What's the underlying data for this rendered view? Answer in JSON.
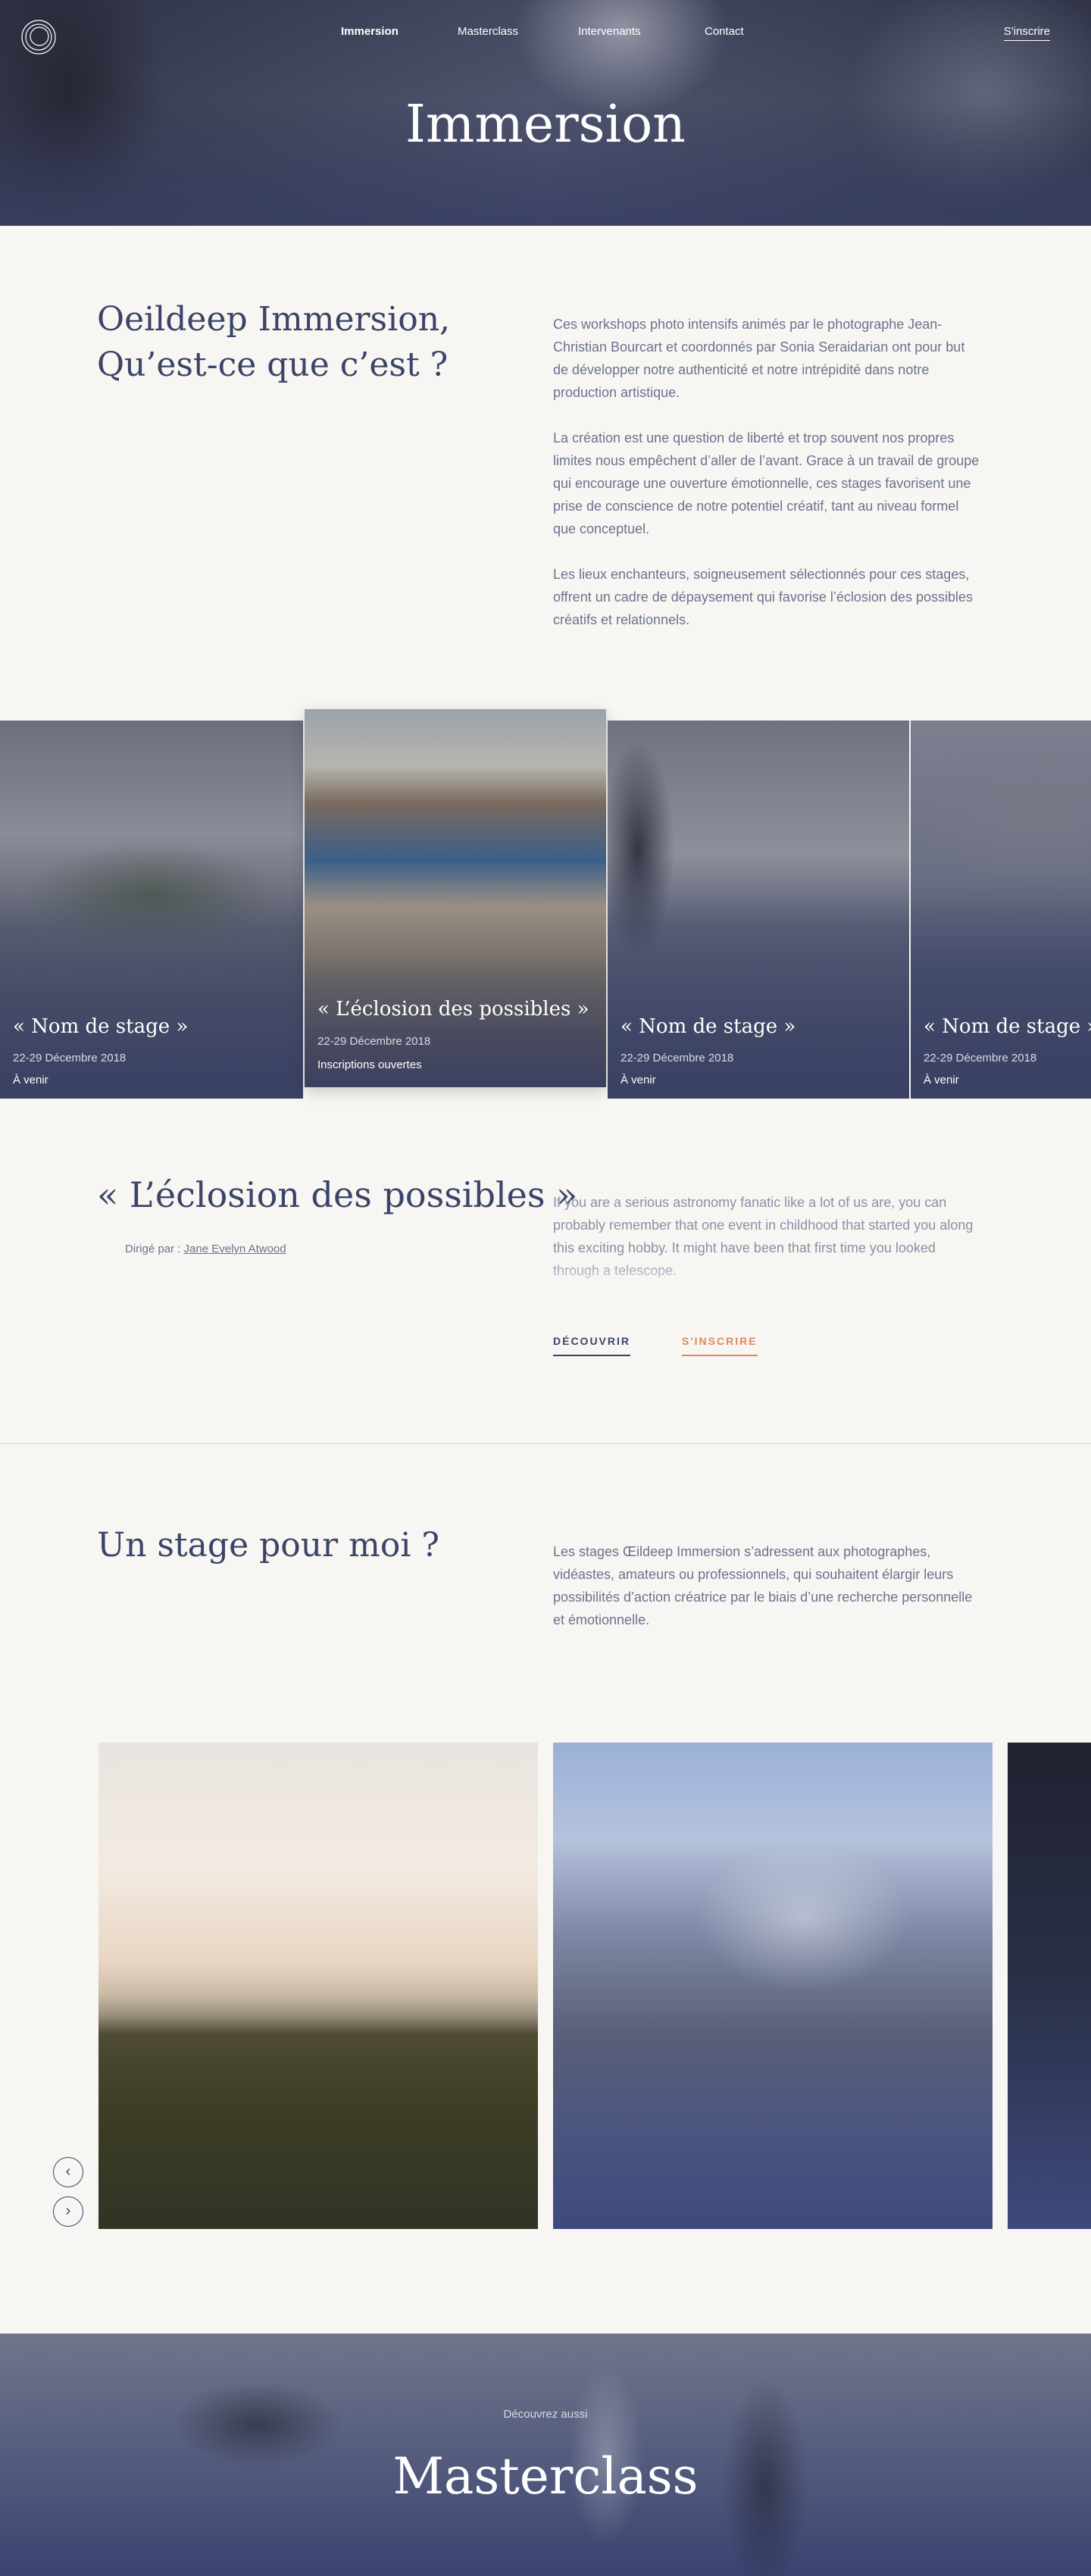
{
  "header": {
    "nav": [
      "Immersion",
      "Masterclass",
      "Intervenants",
      "Contact"
    ],
    "signup": "S'inscrire",
    "title": "Immersion"
  },
  "intro": {
    "title_line1": "Oeildeep Immersion,",
    "title_line2": "Qu’est-ce que c’est ?",
    "paragraphs": [
      "Ces workshops photo intensifs animés par le photographe Jean-Christian Bourcart et coordonnés par Sonia Seraidarian ont pour but de développer notre authenticité et notre intrépidité dans notre production artistique.",
      "La création est une question de liberté et trop souvent nos propres limites nous empêchent d’aller de l’avant. Grace à un travail de groupe qui encourage une ouverture émotionnelle, ces stages favorisent une prise de conscience de notre potentiel créatif, tant au niveau formel que conceptuel.",
      "Les lieux enchanteurs, soigneusement sélectionnés pour ces stages, offrent un cadre de dépaysement qui favorise l’éclosion des possibles créatifs et relationnels."
    ]
  },
  "stages": [
    {
      "name": "« Nom de stage »",
      "date": "22-29 Décembre 2018",
      "status": "À venir"
    },
    {
      "name": "« L’éclosion des possibles »",
      "date": "22-29 Décembre 2018",
      "status": "Inscriptions ouvertes"
    },
    {
      "name": "« Nom de stage »",
      "date": "22-29 Décembre 2018",
      "status": "À venir"
    },
    {
      "name": "« Nom de stage »",
      "date": "22-29 Décembre 2018",
      "status": "À venir"
    }
  ],
  "featured": {
    "title": "« L’éclosion des possibles »",
    "directed_by_label": "Dirigé par :",
    "director": "Jane Evelyn Atwood",
    "text": "If you are a serious astronomy fanatic like a lot of us are, you can probably remember that one event in childhood that started you along this exciting hobby. It might have been that first time you looked through a telescope.",
    "discover": "DÉCOUVRIR",
    "register": "S'INSCRIRE"
  },
  "stage_pour_moi": {
    "title": "Un stage pour moi ?",
    "text": "Les stages Œildeep Immersion s’adressent aux photographes, vidéastes, amateurs ou professionnels, qui souhaitent élargir leurs possibilités d’action créatrice par le biais d’une recherche personnelle et émotionnelle."
  },
  "gallery": {
    "prev": "‹",
    "next": "›"
  },
  "teaser": {
    "subtitle": "Découvrez aussi",
    "title": "Masterclass"
  }
}
